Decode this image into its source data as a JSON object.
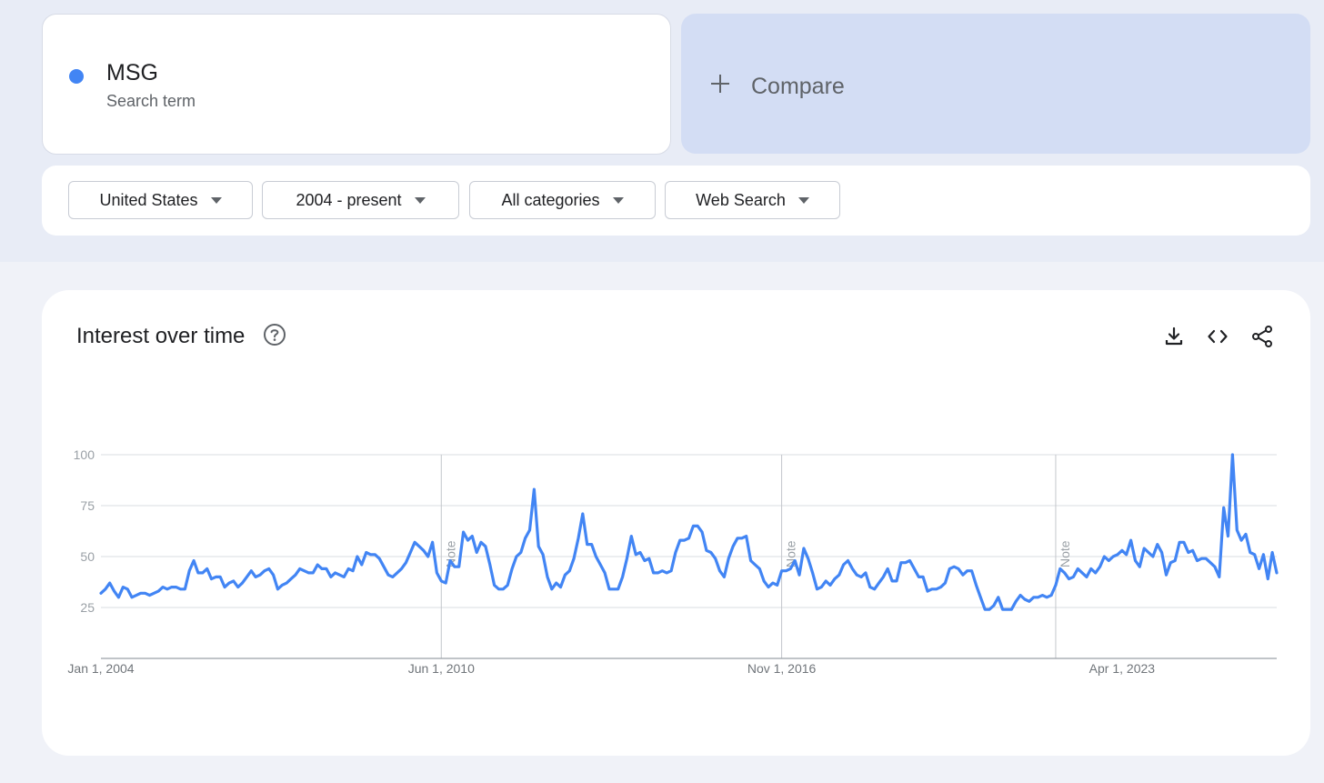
{
  "search_term": {
    "name": "MSG",
    "subtitle": "Search term",
    "dot_color": "#4285f4"
  },
  "compare": {
    "label": "Compare",
    "icon": "plus-icon"
  },
  "filters": [
    {
      "label": "United States"
    },
    {
      "label": "2004 - present"
    },
    {
      "label": "All categories"
    },
    {
      "label": "Web Search"
    }
  ],
  "interest_panel": {
    "title": "Interest over time",
    "icons": [
      "help-icon",
      "download-icon",
      "embed-icon",
      "share-icon"
    ]
  },
  "chart_data": {
    "type": "line",
    "title": "Interest over time",
    "xlabel": "",
    "ylabel": "",
    "ylim": [
      0,
      100
    ],
    "y_ticks": [
      25,
      50,
      75,
      100
    ],
    "x_tick_labels": [
      "Jan 1, 2004",
      "Jun 1, 2010",
      "Nov 1, 2016",
      "Apr 1, 2023"
    ],
    "note_markers": [
      "Note",
      "Note",
      "Note"
    ],
    "grid": true,
    "series": [
      {
        "color": "#4285f4",
        "start": "2004-01",
        "frequency": "monthly",
        "values": [
          32,
          34,
          37,
          33,
          30,
          35,
          34,
          30,
          31,
          32,
          32,
          31,
          32,
          33,
          35,
          34,
          35,
          35,
          34,
          34,
          43,
          48,
          42,
          42,
          44,
          39,
          40,
          40,
          35,
          37,
          38,
          35,
          37,
          40,
          43,
          40,
          41,
          43,
          44,
          41,
          34,
          36,
          37,
          39,
          41,
          44,
          43,
          42,
          42,
          46,
          44,
          44,
          40,
          42,
          41,
          40,
          44,
          43,
          50,
          46,
          52,
          51,
          51,
          49,
          45,
          41,
          40,
          42,
          44,
          47,
          52,
          57,
          55,
          53,
          50,
          57,
          42,
          38,
          37,
          48,
          45,
          45,
          62,
          58,
          60,
          52,
          57,
          55,
          46,
          36,
          34,
          34,
          36,
          44,
          50,
          52,
          59,
          63,
          83,
          55,
          51,
          40,
          34,
          37,
          35,
          41,
          43,
          49,
          59,
          71,
          56,
          56,
          50,
          46,
          42,
          34,
          34,
          34,
          40,
          49,
          60,
          51,
          52,
          48,
          49,
          42,
          42,
          43,
          42,
          43,
          52,
          58,
          58,
          59,
          65,
          65,
          62,
          53,
          52,
          49,
          43,
          40,
          49,
          55,
          59,
          59,
          60,
          48,
          46,
          44,
          38,
          35,
          37,
          36,
          43,
          43,
          44,
          48,
          41,
          54,
          49,
          42,
          34,
          35,
          38,
          36,
          39,
          41,
          46,
          48,
          44,
          41,
          40,
          42,
          35,
          34,
          37,
          40,
          44,
          38,
          38,
          47,
          47,
          48,
          44,
          40,
          40,
          33,
          34,
          34,
          35,
          37,
          44,
          45,
          44,
          41,
          43,
          43,
          36,
          30,
          24,
          24,
          26,
          30,
          24,
          24,
          24,
          28,
          31,
          29,
          28,
          30,
          30,
          31,
          30,
          31,
          36,
          44,
          42,
          39,
          40,
          44,
          42,
          40,
          44,
          42,
          45,
          50,
          48,
          50,
          51,
          53,
          51,
          58,
          48,
          45,
          54,
          52,
          50,
          56,
          52,
          41,
          47,
          48,
          57,
          57,
          52,
          53,
          48,
          49,
          49,
          47,
          45,
          40,
          74,
          60,
          100,
          63,
          58,
          61,
          52,
          51,
          44,
          51,
          39,
          52,
          42
        ]
      }
    ]
  }
}
